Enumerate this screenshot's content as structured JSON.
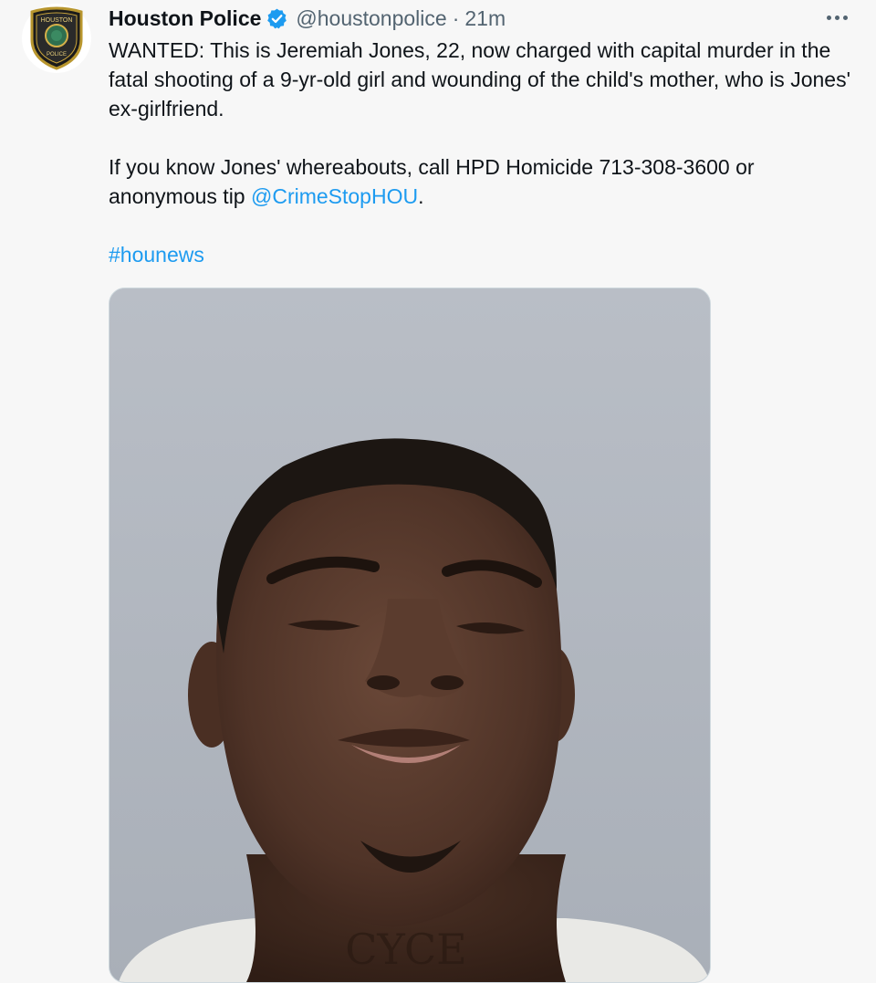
{
  "tweet": {
    "author": {
      "name": "Houston Police",
      "handle": "@houstonpolice",
      "separator": "·",
      "time": "21m",
      "verified": true,
      "avatar_logo_text": [
        "HOUSTON",
        "POLICE"
      ]
    },
    "more_icon": "more-horizontal-icon",
    "text": {
      "p1": "WANTED: This is Jeremiah Jones, 22, now charged with capital murder in the fatal shooting of a 9-yr-old girl and wounding of the child's mother, who is Jones' ex-girlfriend.",
      "p2_before": "If you know Jones' whereabouts, call HPD Homicide 713-308-3600 or anonymous tip ",
      "p2_mention": "@CrimeStopHOU",
      "p2_after": ".",
      "hashtag": "#hounews"
    },
    "media": {
      "tattoo_text": "CYCE"
    }
  },
  "colors": {
    "background": "#f7f7f7",
    "text": "#0f1419",
    "secondary": "#536471",
    "link": "#1d9bf0",
    "verified": "#1d9bf0",
    "photo_backdrop": "#b6bcc5"
  }
}
